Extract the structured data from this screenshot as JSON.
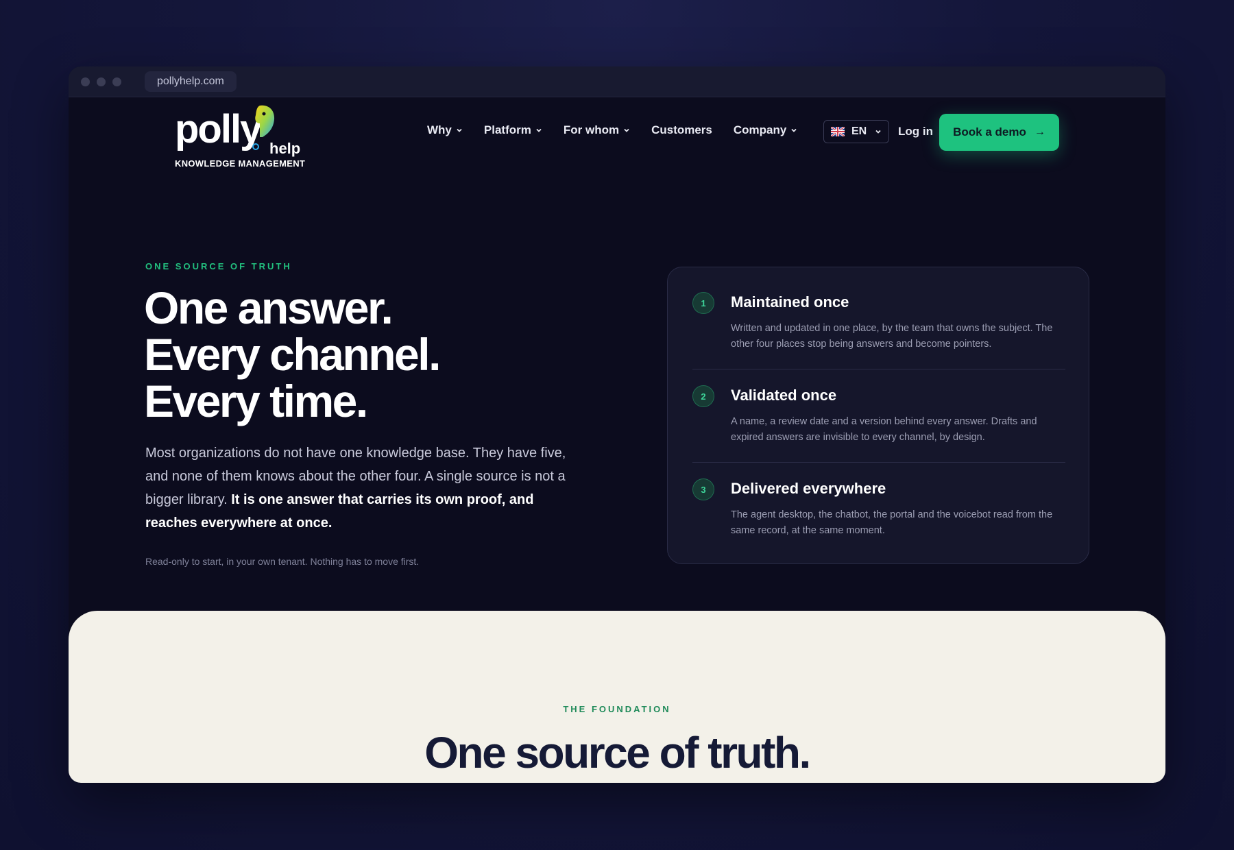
{
  "browser": {
    "url": "pollyhelp.com"
  },
  "logo": {
    "word": "polly",
    "help": "help",
    "tagline": "KNOWLEDGE MANAGEMENT"
  },
  "nav": {
    "items": [
      {
        "label": "Why",
        "dropdown": true
      },
      {
        "label": "Platform",
        "dropdown": true
      },
      {
        "label": "For whom",
        "dropdown": true
      },
      {
        "label": "Customers",
        "dropdown": false
      },
      {
        "label": "Company",
        "dropdown": true
      }
    ],
    "language": "EN",
    "login": "Log in",
    "cta": "Book a demo"
  },
  "hero": {
    "eyebrow": "ONE SOURCE OF TRUTH",
    "headline": [
      "One answer.",
      "Every channel.",
      "Every time."
    ],
    "lead_plain": "Most organizations do not have one knowledge base. They have five, and none of them knows about the other four. A single source is not a bigger library.",
    "lead_bold": "It is one answer that carries its own proof, and reaches everywhere at once.",
    "note": "Read-only to start, in your own tenant. Nothing has to move first."
  },
  "steps": [
    {
      "num": "1",
      "title": "Maintained once",
      "desc": "Written and updated in one place, by the team that owns the subject. The other four places stop being answers and become pointers."
    },
    {
      "num": "2",
      "title": "Validated once",
      "desc": "A name, a review date and a version behind every answer. Drafts and expired answers are invisible to every channel, by design."
    },
    {
      "num": "3",
      "title": "Delivered everywhere",
      "desc": "The agent desktop, the chatbot, the portal and the voicebot read from the same record, at the same moment."
    }
  ],
  "foundation": {
    "eyebrow": "THE FOUNDATION",
    "title": "One source of truth."
  },
  "colors": {
    "accent": "#1ec27f",
    "background": "#0c0c1e",
    "light_section": "#f3f1e9",
    "dark_text": "#151a36"
  }
}
